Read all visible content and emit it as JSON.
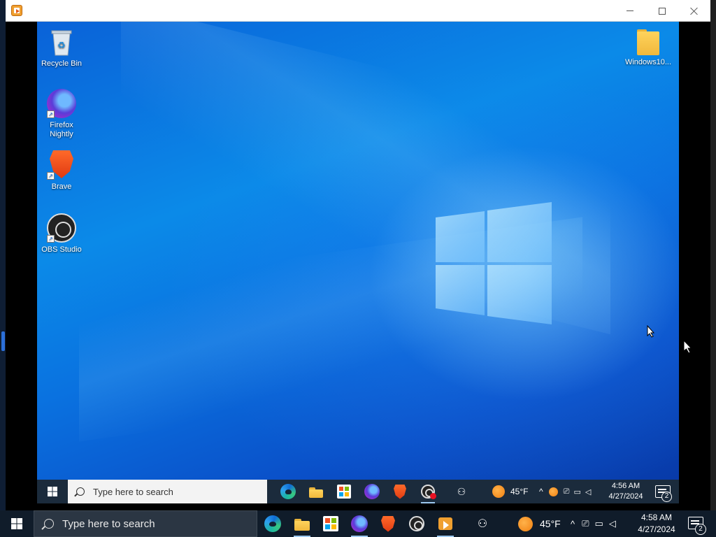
{
  "viewer": {
    "title": "",
    "minimize_label": "Minimize",
    "maximize_label": "Maximize",
    "close_label": "Close"
  },
  "remote_desktop": {
    "icons": [
      {
        "label": "Recycle Bin",
        "icon": "recycle-bin-icon"
      },
      {
        "label": "Firefox Nightly",
        "icon": "firefox-nightly-icon"
      },
      {
        "label": "Brave",
        "icon": "brave-icon"
      },
      {
        "label": "OBS Studio",
        "icon": "obs-studio-icon"
      },
      {
        "label": "Windows10...",
        "icon": "folder-icon"
      }
    ],
    "taskbar": {
      "search_placeholder": "Type here to search",
      "apps": [
        "edge-icon",
        "file-explorer-icon",
        "store-icon",
        "firefox-nightly-icon",
        "brave-icon",
        "obs-studio-icon"
      ],
      "weather": "45°F",
      "clock_time": "4:56 AM",
      "clock_date": "4/27/2024",
      "notification_count": "2"
    }
  },
  "host_taskbar": {
    "search_placeholder": "Type here to search",
    "apps": [
      "edge-icon",
      "file-explorer-icon",
      "store-icon",
      "firefox-nightly-icon",
      "brave-icon",
      "obs-studio-icon",
      "media-player-icon"
    ],
    "weather": "45°F",
    "clock_time": "4:58 AM",
    "clock_date": "4/27/2024",
    "notification_count": "2"
  },
  "colors": {
    "wallpaper_blue": "#0a72e0",
    "taskbar": "#101c2a",
    "accent": "#9ec9f0"
  }
}
